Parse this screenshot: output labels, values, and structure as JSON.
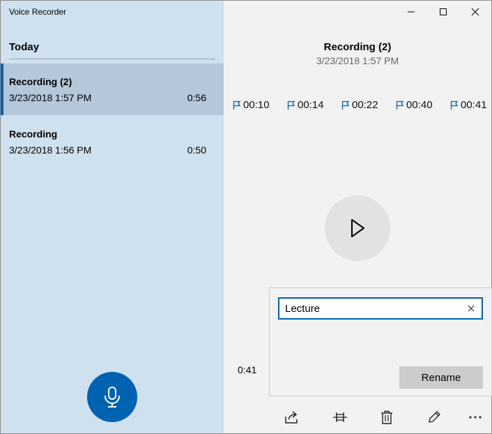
{
  "window": {
    "title": "Voice Recorder",
    "controls": [
      "minimize-icon",
      "maximize-icon",
      "close-icon"
    ]
  },
  "sidebar": {
    "section_header": "Today",
    "recordings": [
      {
        "name": "Recording (2)",
        "date": "3/23/2018 1:57 PM",
        "duration": "0:56",
        "selected": true
      },
      {
        "name": "Recording",
        "date": "3/23/2018 1:56 PM",
        "duration": "0:50",
        "selected": false
      }
    ],
    "record_icon": "microphone-icon"
  },
  "detail": {
    "title": "Recording (2)",
    "date": "3/23/2018 1:57 PM",
    "markers": [
      "00:10",
      "00:14",
      "00:22",
      "00:40",
      "00:41"
    ],
    "marker_icon": "flag-icon",
    "play_icon": "play-icon",
    "time_label": "0:41"
  },
  "rename_flyout": {
    "input_value": "Lecture ",
    "clear_icon": "clear-icon",
    "button_label": "Rename"
  },
  "toolbar": {
    "icons": [
      "share-icon",
      "trim-icon",
      "delete-icon",
      "rename-icon",
      "more-icon"
    ]
  },
  "colors": {
    "accent": "#0063b1",
    "sidebar_bg": "#cfe0ef",
    "selected_bg": "#b4c8d9",
    "content_bg": "#f2f2f2"
  }
}
